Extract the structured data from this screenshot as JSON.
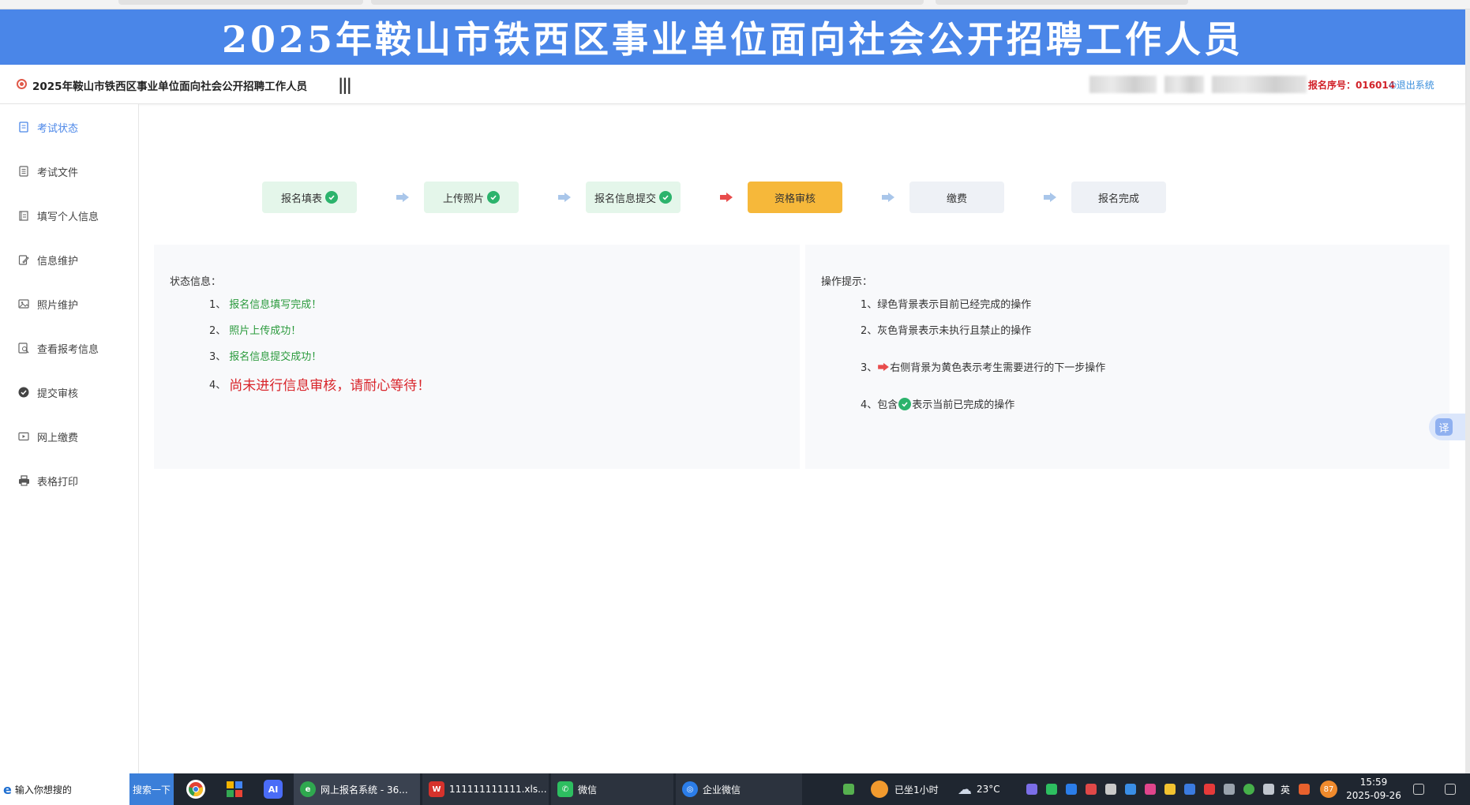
{
  "banner": {
    "title": "2025年鞍山市铁西区事业单位面向社会公开招聘工作人员"
  },
  "header": {
    "title": "2025年鞍山市铁西区事业单位面向社会公开招聘工作人员",
    "menu_toggle": "|||",
    "reg_number": "报名序号：016014",
    "logout": "退出系统"
  },
  "sidebar": {
    "items": [
      {
        "label": "考试状态",
        "icon": "doc-icon",
        "active": true
      },
      {
        "label": "考试文件",
        "icon": "file-icon"
      },
      {
        "label": "填写个人信息",
        "icon": "edit-list-icon"
      },
      {
        "label": "信息维护",
        "icon": "pencil-doc-icon"
      },
      {
        "label": "照片维护",
        "icon": "image-icon"
      },
      {
        "label": "查看报考信息",
        "icon": "search-doc-icon"
      },
      {
        "label": "提交审核",
        "icon": "check-circle-icon"
      },
      {
        "label": "网上缴费",
        "icon": "pay-icon"
      },
      {
        "label": "表格打印",
        "icon": "printer-icon"
      }
    ]
  },
  "steps": [
    {
      "label": "报名填表",
      "state": "done"
    },
    {
      "label": "上传照片",
      "state": "done"
    },
    {
      "label": "报名信息提交",
      "state": "done"
    },
    {
      "label": "资格审核",
      "state": "current"
    },
    {
      "label": "缴费",
      "state": "todo"
    },
    {
      "label": "报名完成",
      "state": "todo"
    }
  ],
  "status_panel": {
    "heading": "状态信息：",
    "lines": [
      {
        "num": "1、",
        "text": "报名信息填写完成！"
      },
      {
        "num": "2、",
        "text": "照片上传成功！"
      },
      {
        "num": "3、",
        "text": "报名信息提交成功！"
      },
      {
        "num": "4、",
        "text": "尚未进行信息审核，请耐心等待！"
      }
    ]
  },
  "hint_panel": {
    "heading": "操作提示：",
    "line1": {
      "num": "1、",
      "text": "绿色背景表示目前已经完成的操作"
    },
    "line2": {
      "num": "2、",
      "text": "灰色背景表示未执行且禁止的操作"
    },
    "line3": {
      "num": "3、",
      "text": "右侧背景为黄色表示考生需要进行的下一步操作"
    },
    "line4": {
      "num": "4、",
      "pre": "包含",
      "post": "表示当前已完成的操作"
    }
  },
  "translate": {
    "label": "译"
  },
  "taskbar": {
    "search_placeholder": "输入你想搜的",
    "search_button": "搜索一下",
    "apps": [
      {
        "label": "网上报名系统 - 36...",
        "state": "active"
      },
      {
        "label": "111111111111.xls...",
        "state": "open"
      },
      {
        "label": "微信",
        "state": "open"
      },
      {
        "label": "企业微信",
        "state": "open"
      }
    ],
    "sitting": "已坐1小时",
    "weather": "23°C",
    "ime": "英",
    "badge": "87",
    "time": "15:59",
    "date": "2025-09-26"
  },
  "colors": {
    "banner": "#4a86e8",
    "done": "#e4f6ea",
    "current": "#f6b83a",
    "todo": "#eef1f6",
    "success_green": "#2a9a3c",
    "alert_red": "#d9242a"
  }
}
